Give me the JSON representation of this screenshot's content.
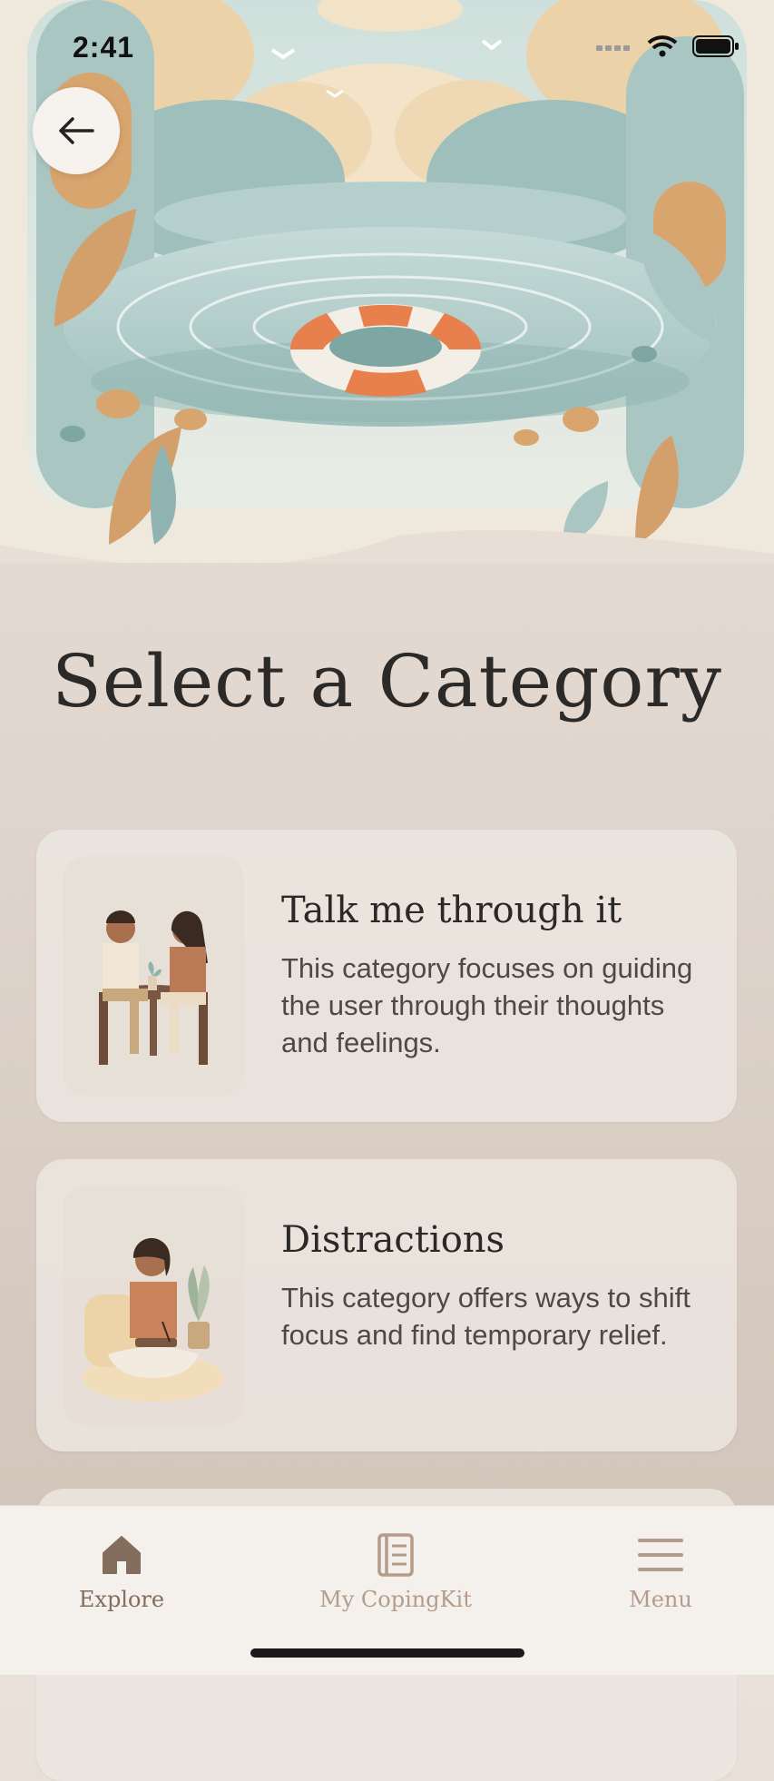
{
  "status_bar": {
    "time": "2:41"
  },
  "page": {
    "title": "Select a Category"
  },
  "categories": [
    {
      "title": "Talk me through it",
      "description": "This category focuses on guiding the user through their thoughts and feelings."
    },
    {
      "title": "Distractions",
      "description": "This category offers ways to shift focus and find temporary relief."
    }
  ],
  "tabs": [
    {
      "label": "Explore",
      "icon": "home-icon",
      "active": true
    },
    {
      "label": "My CopingKit",
      "icon": "journal-icon",
      "active": false
    },
    {
      "label": "Menu",
      "icon": "menu-icon",
      "active": false
    }
  ],
  "colors": {
    "accent": "#836d5d",
    "inactive": "#b49c8a",
    "teal": "#8fb3b0",
    "orange": "#e8804e"
  }
}
